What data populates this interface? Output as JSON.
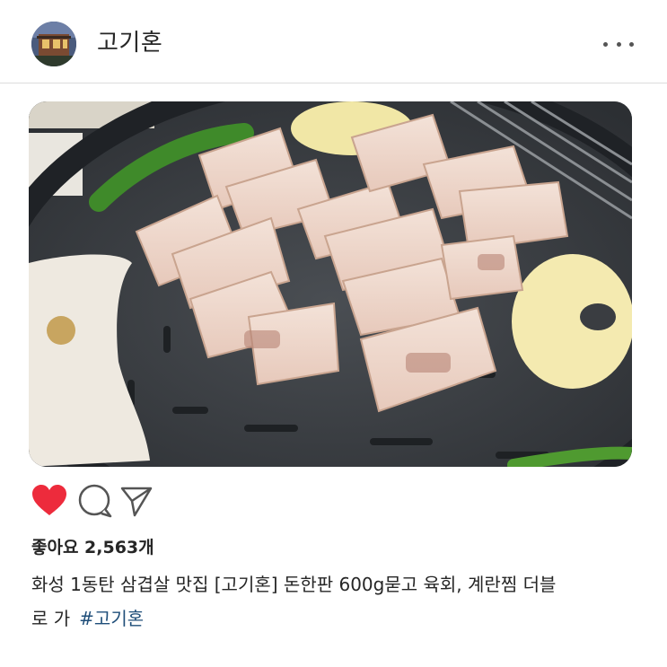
{
  "post": {
    "username": "고기혼",
    "photo_alt": "",
    "likes_text": "좋아요 2,563개",
    "caption_line1": "화성 1동탄 삼겹살 맛집 [고기혼] 돈한판 600g묻고 육회, 계란찜 더블",
    "caption_line2": "로 가",
    "hashtag": "#고기혼"
  },
  "icons": {
    "more": "more-options-icon",
    "like": "heart-icon",
    "comment": "comment-icon",
    "share": "send-icon"
  },
  "colors": {
    "like_active": "#ed2b3c",
    "hashtag": "#1f4e79",
    "text": "#262626"
  }
}
